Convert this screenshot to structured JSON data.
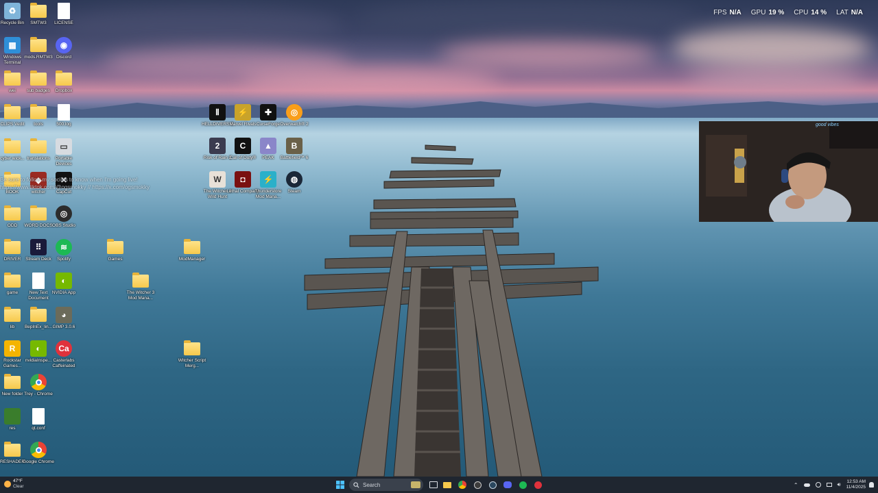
{
  "perf_overlay": [
    {
      "key": "FPS",
      "value": "N/A"
    },
    {
      "key": "GPU",
      "value": "19 %"
    },
    {
      "key": "CPU",
      "value": "14 %"
    },
    {
      "key": "LAT",
      "value": "N/A"
    }
  ],
  "desktop_icons": [
    {
      "label": "Recycle Bin",
      "icon": "recycle-bin-icon",
      "kind": "app",
      "color": "#7fb4d9"
    },
    {
      "label": "SMTW3",
      "icon": "folder-icon",
      "kind": "folder"
    },
    {
      "label": "LICENSE",
      "icon": "document-icon",
      "kind": "doc"
    },
    {
      "label": "Windows Terminal",
      "icon": "windows-icon",
      "kind": "app",
      "color": "#2f8fd8"
    },
    {
      "label": "mods.RMTW3",
      "icon": "folder-icon",
      "kind": "folder"
    },
    {
      "label": "Discord",
      "icon": "discord-icon",
      "kind": "app",
      "color": "#5865f2"
    },
    {
      "label": "wei",
      "icon": "folder-icon",
      "kind": "folder"
    },
    {
      "label": "sub badges",
      "icon": "folder-icon",
      "kind": "folder"
    },
    {
      "label": "Dropbox",
      "icon": "folder-icon",
      "kind": "folder"
    },
    {
      "label": "CLIPS Vedit",
      "icon": "folder-icon",
      "kind": "folder"
    },
    {
      "label": "tools",
      "icon": "folder-icon",
      "kind": "folder"
    },
    {
      "label": "500.log",
      "icon": "document-icon",
      "kind": "doc"
    },
    {
      "label": "cyber wick...",
      "icon": "folder-icon",
      "kind": "folder"
    },
    {
      "label": "translations",
      "icon": "folder-icon",
      "kind": "folder"
    },
    {
      "label": "Portable Devices",
      "icon": "drive-icon",
      "kind": "app",
      "color": "#d7dbe0"
    },
    {
      "label": "BOOK",
      "icon": "folder-icon",
      "kind": "folder"
    },
    {
      "label": "witcher",
      "icon": "app-icon",
      "kind": "app",
      "color": "#9a2a22"
    },
    {
      "label": "CapCut",
      "icon": "capcut-icon",
      "kind": "app",
      "color": "#111111"
    },
    {
      "label": "ODD",
      "icon": "folder-icon",
      "kind": "folder"
    },
    {
      "label": "WORD DOCS",
      "icon": "folder-icon",
      "kind": "folder"
    },
    {
      "label": "OBS Studio",
      "icon": "obs-icon",
      "kind": "app",
      "color": "#2c2c2c"
    },
    {
      "label": "DRIVER",
      "icon": "folder-icon",
      "kind": "folder"
    },
    {
      "label": "Stream Deck",
      "icon": "stream-deck-icon",
      "kind": "app",
      "color": "#1a1a3a"
    },
    {
      "label": "Spotify",
      "icon": "spotify-icon",
      "kind": "app",
      "color": "#1db954"
    },
    {
      "label": "game",
      "icon": "folder-icon",
      "kind": "folder"
    },
    {
      "label": "New Text Document",
      "icon": "document-icon",
      "kind": "doc"
    },
    {
      "label": "NVIDIA App",
      "icon": "nvidia-icon",
      "kind": "app",
      "color": "#76b900"
    },
    {
      "label": "lib",
      "icon": "folder-icon",
      "kind": "folder"
    },
    {
      "label": "BepInEx_lin...",
      "icon": "folder-icon",
      "kind": "folder"
    },
    {
      "label": "GIMP 3.0.6",
      "icon": "gimp-icon",
      "kind": "app",
      "color": "#6b6b5a"
    },
    {
      "label": "Rockstar Games...",
      "icon": "rockstar-icon",
      "kind": "app",
      "color": "#f4b400"
    },
    {
      "label": "nvidiaInspe...",
      "icon": "nvidia-icon",
      "kind": "app",
      "color": "#76b900"
    },
    {
      "label": "Casterlabs Caffeinated",
      "icon": "casterlabs-icon",
      "kind": "app",
      "color": "#e0323c"
    },
    {
      "label": "New folder",
      "icon": "folder-icon",
      "kind": "folder"
    },
    {
      "label": "Trey - Chrome",
      "icon": "chrome-icon",
      "kind": "chrome"
    },
    {
      "label": "res",
      "icon": "folder-icon",
      "kind": "app",
      "color": "#3a7d2c"
    },
    {
      "label": "qt.conf",
      "icon": "document-icon",
      "kind": "doc"
    },
    {
      "label": "RESHADER",
      "icon": "folder-icon",
      "kind": "folder"
    },
    {
      "label": "Google Chrome",
      "icon": "chrome-icon",
      "kind": "chrome"
    },
    {
      "label": "Games",
      "icon": "folder-icon",
      "kind": "folder"
    },
    {
      "label": "ModManager",
      "icon": "folder-icon",
      "kind": "folder"
    },
    {
      "label": "The Witcher 3 Mod Mana...",
      "icon": "folder-icon",
      "kind": "folder"
    },
    {
      "label": "Witcher Script Merg...",
      "icon": "folder-icon",
      "kind": "folder"
    },
    {
      "label": "HELLDIVERS 2",
      "icon": "helldivers-icon",
      "kind": "app",
      "color": "#111111"
    },
    {
      "label": "Marvel Rivals",
      "icon": "marvel-rivals-icon",
      "kind": "app",
      "color": "#c9a32a"
    },
    {
      "label": "CurseForge",
      "icon": "curseforge-icon",
      "kind": "app",
      "color": "#111111"
    },
    {
      "label": "Overwatch® 2",
      "icon": "overwatch-icon",
      "kind": "app",
      "color": "#f99e1a"
    },
    {
      "label": "Risk of Rain 2",
      "icon": "risk-of-rain-icon",
      "kind": "app",
      "color": "#3b3b4f"
    },
    {
      "label": "Call of Duty®",
      "icon": "call-of-duty-icon",
      "kind": "app",
      "color": "#111111"
    },
    {
      "label": "PEAK",
      "icon": "peak-icon",
      "kind": "app",
      "color": "#8a86c9"
    },
    {
      "label": "Battlefield™ 6",
      "icon": "battlefield-icon",
      "kind": "app",
      "color": "#6a6048"
    },
    {
      "label": "The Witcher 3 Wild Hunt",
      "icon": "witcher-icon",
      "kind": "app",
      "color": "#e8e1d8"
    },
    {
      "label": "Lethal Company",
      "icon": "lethal-company-icon",
      "kind": "app",
      "color": "#7a1010"
    },
    {
      "label": "Thunderstore Mod Mana...",
      "icon": "thunderstore-icon",
      "kind": "app",
      "color": "#2bb0c9"
    },
    {
      "label": "Steam",
      "icon": "steam-icon",
      "kind": "app",
      "color": "#1b2838"
    }
  ],
  "chat_overlay": {
    "line1": "Be sure to follow my socials to know when I'm going live!",
    "line2": "https://www.tiktok.com/@ogsmokky // https://x.com/ogsmokky"
  },
  "webcam": {
    "label": "webcam-feed",
    "badge": "good vibes"
  },
  "taskbar": {
    "weather_temp": "47°F",
    "weather_desc": "Clear",
    "search_placeholder": "Search",
    "time": "12:53 AM",
    "date": "11/4/2025"
  },
  "colors": {
    "taskbar_bg": "#1f2630",
    "folder": "#f6c94c",
    "accent": "#0078d4"
  }
}
